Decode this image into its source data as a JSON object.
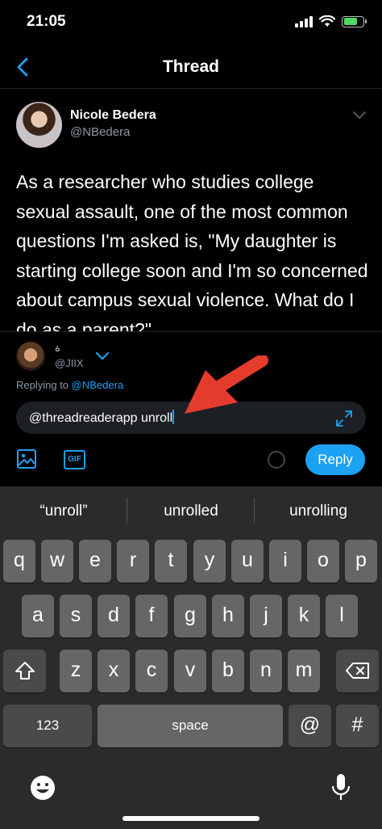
{
  "status_bar": {
    "time": "21:05"
  },
  "nav": {
    "title": "Thread"
  },
  "tweet": {
    "author_name": "Nicole Bedera",
    "author_handle": "@NBedera",
    "text": "As a researcher who studies college sexual assault, one of the most common questions I'm asked is, \"My daughter is starting college soon and I'm so concerned about campus sexual violence. What do I do as a parent?\""
  },
  "compose": {
    "user_name": "ة",
    "user_handle": "@JIIX",
    "replying_prefix": "Replying to",
    "replying_to": "@NBedera",
    "input_value": "@threadreaderapp unroll",
    "gif_label": "GIF",
    "reply_label": "Reply"
  },
  "keyboard": {
    "suggestions": [
      "“unroll”",
      "unrolled",
      "unrolling"
    ],
    "row1": [
      "q",
      "w",
      "e",
      "r",
      "t",
      "y",
      "u",
      "i",
      "o",
      "p"
    ],
    "row2": [
      "a",
      "s",
      "d",
      "f",
      "g",
      "h",
      "j",
      "k",
      "l"
    ],
    "row3": [
      "z",
      "x",
      "c",
      "v",
      "b",
      "n",
      "m"
    ],
    "numbers_label": "123",
    "space_label": "space",
    "at_label": "@",
    "hash_label": "#"
  },
  "colors": {
    "accent": "#1da1f2",
    "arrow": "#e53b2c"
  }
}
